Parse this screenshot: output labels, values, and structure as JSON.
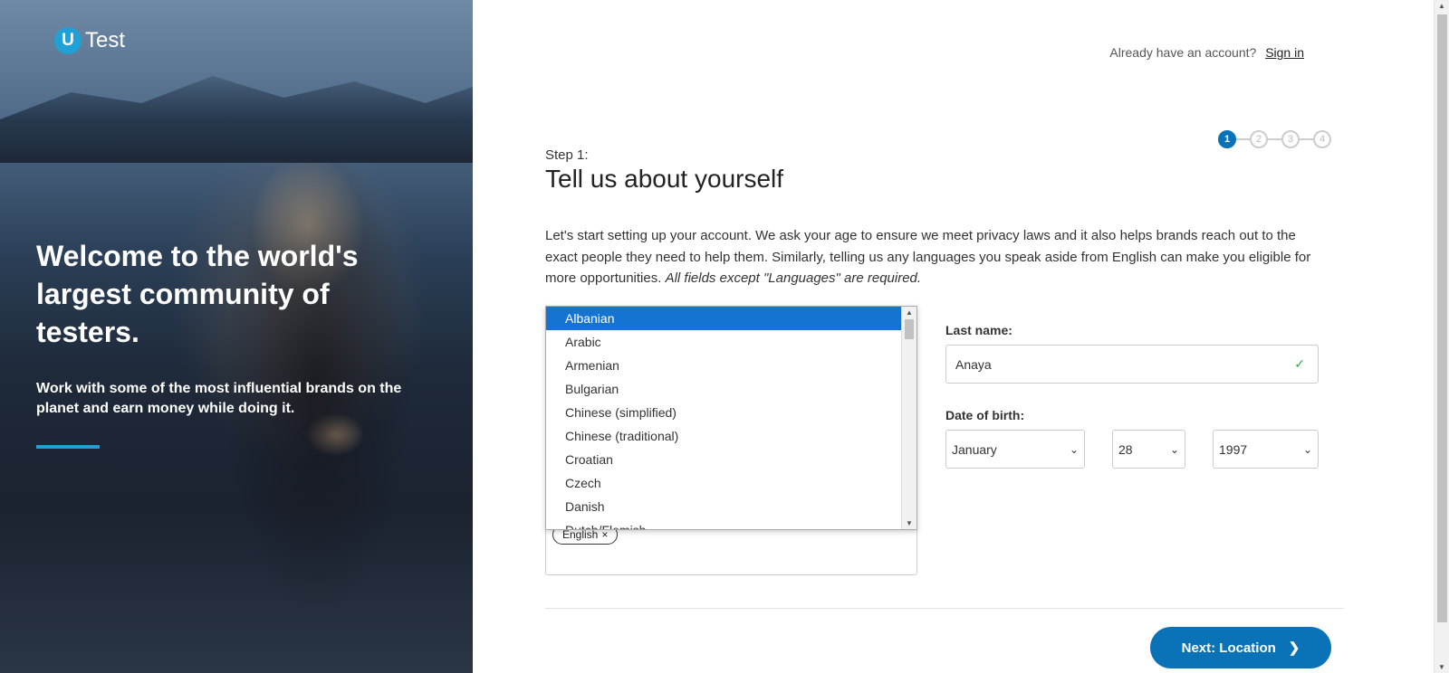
{
  "hero": {
    "logo_letter": "U",
    "logo_text": "Test",
    "headline": "Welcome to the world's largest community of testers.",
    "subtext": "Work with some of the most influential brands on the planet and earn money while doing it."
  },
  "header": {
    "account_prompt": "Already have an account?",
    "signin_label": "Sign in"
  },
  "progress": {
    "steps": [
      "1",
      "2",
      "3",
      "4"
    ],
    "current_step": 1
  },
  "form": {
    "step_label": "Step 1:",
    "title": "Tell us about yourself",
    "intro": "Let's start setting up your account. We ask your age to ensure we meet privacy laws and it also helps brands reach out to the exact people they need to help them. Similarly, telling us any languages you speak aside from English can make you eligible for more opportunities.",
    "intro_note": "All fields except \"Languages\" are required.",
    "last_name_label": "Last name:",
    "last_name_value": "Anaya",
    "dob_label": "Date of birth:",
    "dob_month": "January",
    "dob_day": "28",
    "dob_year": "1997",
    "language_chip": "English"
  },
  "language_dropdown": {
    "options": [
      "Albanian",
      "Arabic",
      "Armenian",
      "Bulgarian",
      "Chinese (simplified)",
      "Chinese (traditional)",
      "Croatian",
      "Czech",
      "Danish",
      "Dutch/Flemish"
    ],
    "selected": "Albanian"
  },
  "footer": {
    "next_label": "Next: Location"
  },
  "colors": {
    "primary": "#0a73b8",
    "accent": "#1fa1d6",
    "selected_option": "#1574d2",
    "success": "#2eae4f"
  }
}
